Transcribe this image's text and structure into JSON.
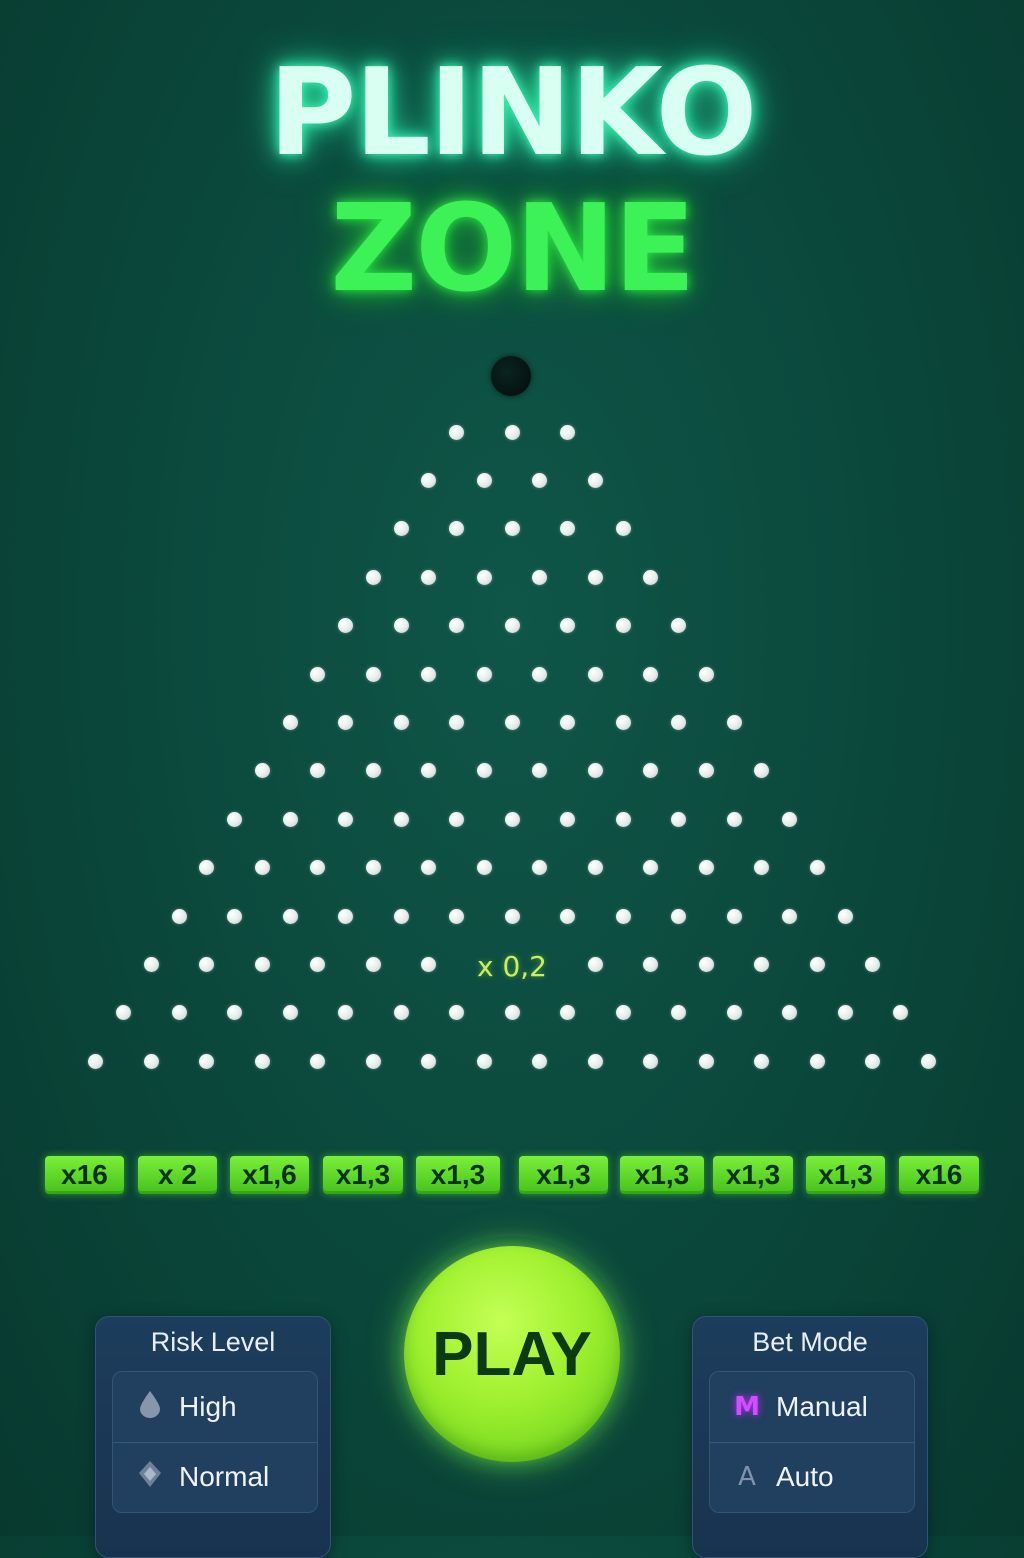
{
  "title": {
    "line1": "PLINKO",
    "line2": "ZONE"
  },
  "board": {
    "peg_rows": 14,
    "pegs_first_row": 3,
    "center_multiplier": "x 0,2"
  },
  "buckets": [
    "x16",
    "x 2",
    "x1,6",
    "x1,3",
    "x1,3",
    "x1,3",
    "x1,3",
    "x1,3",
    "x1,3",
    "x16"
  ],
  "play": {
    "label": "PLAY"
  },
  "risk_level": {
    "title": "Risk Level",
    "options": [
      {
        "label": "High",
        "icon": "droplet-icon"
      },
      {
        "label": "Normal",
        "icon": "layered-diamond-icon"
      }
    ]
  },
  "bet_mode": {
    "title": "Bet Mode",
    "options": [
      {
        "label": "Manual",
        "icon_text": "M",
        "color": "#d24dff"
      },
      {
        "label": "Auto",
        "icon_text": "A",
        "color": "#7f93ad"
      }
    ]
  },
  "colors": {
    "background": "#0b4a3d",
    "title_line1": "#d9fff2",
    "title_line2": "#3cf256",
    "bucket": "#6de033",
    "play_button": "#a8f535",
    "panel": "#1b3a58"
  }
}
